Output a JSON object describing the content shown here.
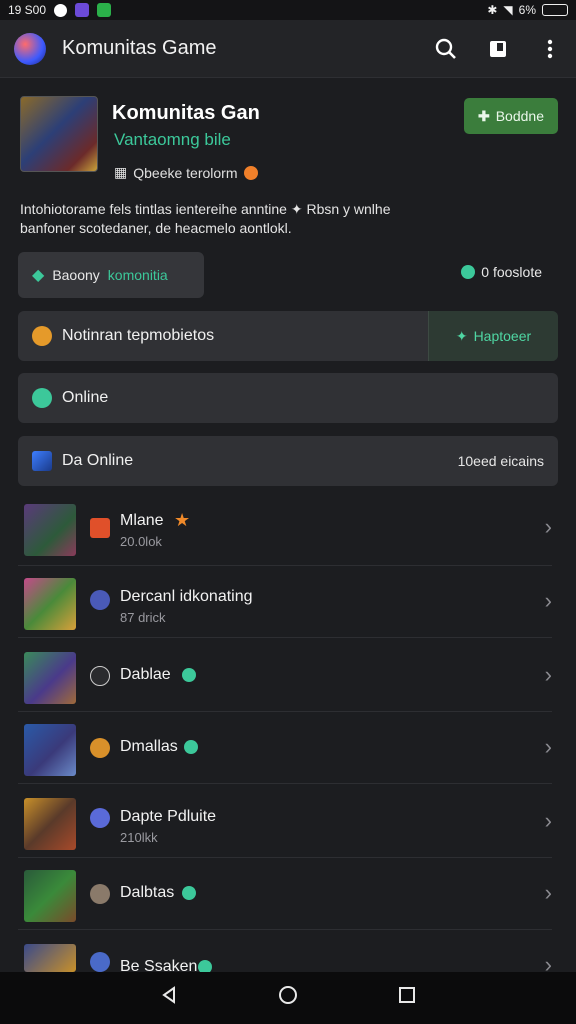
{
  "status_bar": {
    "time": "19 S00",
    "battery": "6%"
  },
  "app_bar": {
    "title": "Komunitas Game"
  },
  "game": {
    "name": "Komunitas Gan",
    "subtitle": "Vantaomng bile",
    "meta": "Qbeeke terolorm",
    "join_label": "Boddne"
  },
  "description": "Intohiotorame fels tintlas ientereihe anntine ✦ Rbsn y wnlhe banfoner scotedaner, de heacmelo aontlokl.",
  "community_pill": {
    "prefix": "Baoony",
    "accent": "komonitia"
  },
  "right_count": "0 fooslote",
  "notification_bar": {
    "label": "Notinran tepmobietos",
    "action": "Haptoeer"
  },
  "online_bar": {
    "label": "Online"
  },
  "da_online_bar": {
    "label": "Da Online",
    "right": "10eed eicains"
  },
  "list": [
    {
      "name": "Mlane",
      "sub": "20.0lok"
    },
    {
      "name": "Dercanl idkonating",
      "sub": "87 drick"
    },
    {
      "name": "Dablae",
      "sub": ""
    },
    {
      "name": "Dmallas",
      "sub": ""
    },
    {
      "name": "Dapte Pdluite",
      "sub": "210lkk"
    },
    {
      "name": "Dalbtas",
      "sub": ""
    },
    {
      "name": "Be Ssaken",
      "sub": ""
    }
  ],
  "colors": {
    "accent_green": "#3cc89a",
    "join_green": "#3b7d3c",
    "background": "#1c1d20"
  }
}
